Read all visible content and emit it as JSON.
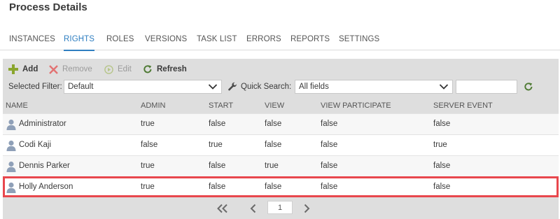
{
  "page": {
    "title": "Process Details"
  },
  "tabs": [
    {
      "label": "INSTANCES"
    },
    {
      "label": "RIGHTS",
      "active": true
    },
    {
      "label": "ROLES"
    },
    {
      "label": "VERSIONS"
    },
    {
      "label": "TASK LIST"
    },
    {
      "label": "ERRORS"
    },
    {
      "label": "REPORTS"
    },
    {
      "label": "SETTINGS"
    }
  ],
  "toolbar": {
    "add_label": "Add",
    "remove_label": "Remove",
    "edit_label": "Edit",
    "refresh_label": "Refresh"
  },
  "filter": {
    "selected_filter_label": "Selected Filter:",
    "selected_filter_value": "Default",
    "quick_search_label": "Quick Search:",
    "quick_search_field": "All fields",
    "quick_search_text": ""
  },
  "grid": {
    "columns": [
      "NAME",
      "ADMIN",
      "START",
      "VIEW",
      "VIEW PARTICIPATE",
      "SERVER EVENT"
    ],
    "rows": [
      {
        "name": "Administrator",
        "admin": "true",
        "start": "false",
        "view": "false",
        "view_participate": "false",
        "server_event": "false"
      },
      {
        "name": "Codi Kaji",
        "admin": "false",
        "start": "true",
        "view": "false",
        "view_participate": "false",
        "server_event": "true"
      },
      {
        "name": "Dennis Parker",
        "admin": "true",
        "start": "false",
        "view": "true",
        "view_participate": "false",
        "server_event": "false"
      },
      {
        "name": "Holly Anderson",
        "admin": "true",
        "start": "false",
        "view": "false",
        "view_participate": "false",
        "server_event": "false",
        "highlighted": true
      }
    ]
  },
  "pager": {
    "current_page": "1"
  },
  "colors": {
    "accent": "#2f7fc1",
    "highlight": "#e8474d",
    "add_green": "#8aa52e",
    "remove_red": "#e24b4b"
  }
}
